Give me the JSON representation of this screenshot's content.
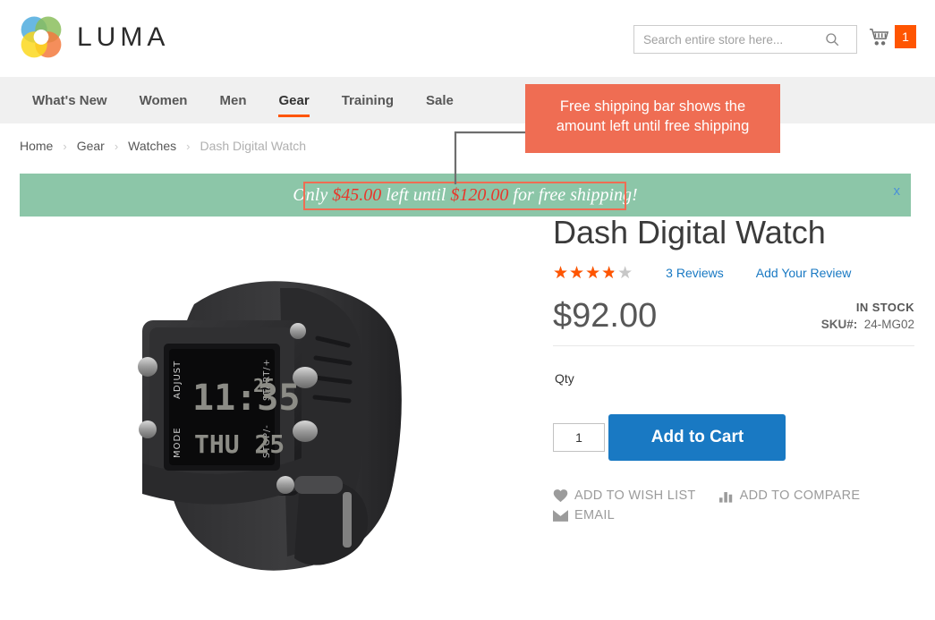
{
  "header": {
    "brand": "LUMA",
    "logo_icon": "luma-circles-logo",
    "search": {
      "placeholder": "Search entire store here...",
      "value": "",
      "icon": "search-icon"
    },
    "cart": {
      "icon": "shopping-cart-icon",
      "count": "1",
      "badge_color": "#ff5501"
    }
  },
  "nav": {
    "items": [
      {
        "label": "What's New",
        "active": false
      },
      {
        "label": "Women",
        "active": false
      },
      {
        "label": "Men",
        "active": false
      },
      {
        "label": "Gear",
        "active": true
      },
      {
        "label": "Training",
        "active": false
      },
      {
        "label": "Sale",
        "active": false
      }
    ],
    "active_underline_color": "#ff5501"
  },
  "breadcrumb": {
    "separator": "›",
    "items": [
      {
        "label": "Home",
        "current": false
      },
      {
        "label": "Gear",
        "current": false
      },
      {
        "label": "Watches",
        "current": false
      },
      {
        "label": "Dash Digital Watch",
        "current": true
      }
    ]
  },
  "shipping_bar": {
    "background_color": "#8cc6a8",
    "text_prefix": "Only ",
    "amount_left": "$45.00",
    "text_middle": " left until ",
    "threshold": "$120.00",
    "text_suffix": " for free shipping!",
    "amount_color": "#e8372b",
    "close_label": "x",
    "highlight_color": "#ef6d53"
  },
  "annotation": {
    "text": "Free shipping bar shows the amount left until free shipping",
    "background_color": "#ef6d53",
    "text_color": "#ffffff",
    "connector_color": "#6e6e6e"
  },
  "product": {
    "title": "Dash Digital Watch",
    "image_alt": "Dash Digital Watch black digital wristwatch",
    "watch_display": {
      "time": "11:35",
      "seconds": "25",
      "date": "THU 25",
      "label_adjust": "ADJUST",
      "label_mode": "MODE",
      "label_start": "START/+",
      "label_stop": "STOP/-"
    },
    "rating": {
      "value_percent": 75,
      "stars_glyph": "★★★★★",
      "filled_color": "#ff5501",
      "empty_color": "#c7c7c7"
    },
    "reviews_link": "3 Reviews",
    "add_review_link": "Add Your Review",
    "price": "$92.00",
    "stock_status": "IN STOCK",
    "sku_label": "SKU#:",
    "sku_value": "24-MG02",
    "qty_label": "Qty",
    "qty_value": "1",
    "add_to_cart_label": "Add to Cart",
    "add_to_cart_color": "#1979c3",
    "links": [
      {
        "label": "ADD TO WISH LIST",
        "icon": "heart-icon"
      },
      {
        "label": "ADD TO COMPARE",
        "icon": "bar-chart-icon"
      },
      {
        "label": "EMAIL",
        "icon": "envelope-icon"
      }
    ]
  }
}
